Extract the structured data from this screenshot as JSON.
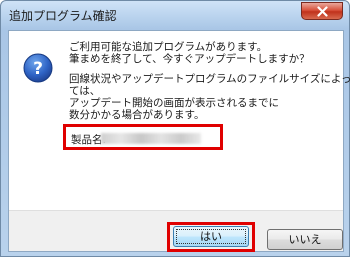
{
  "window": {
    "title": "追加プログラム確認"
  },
  "message": {
    "line1": "ご利用可能な追加プログラムがあります。",
    "line2": "筆まめを終了して、今すぐアップデートしますか？",
    "line3": "回線状況やアップデートプログラムのファイルサイズによっ",
    "line4": "ては、",
    "line5": "アップデート開始の画面が表示されるまでに",
    "line6": "数分かかる場合があります。"
  },
  "product": {
    "label": "製品名:"
  },
  "buttons": {
    "yes": "はい",
    "no": "いいえ"
  },
  "colors": {
    "highlight": "#e00000",
    "titlebar": "#bcd5ef"
  }
}
